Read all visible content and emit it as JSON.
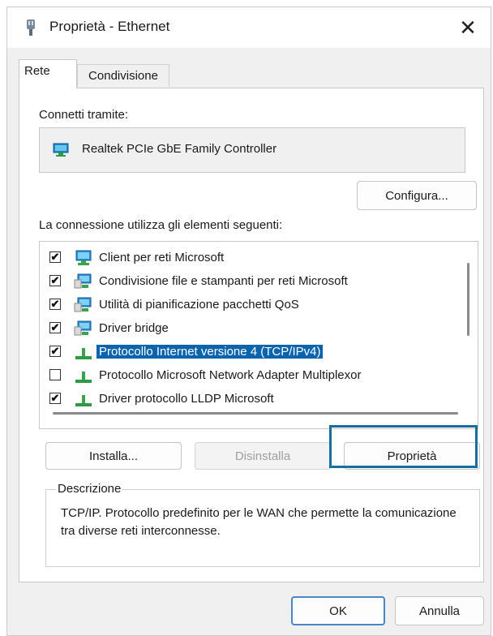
{
  "window": {
    "title": "Proprietà - Ethernet",
    "close_glyph": "✕"
  },
  "tabs": [
    {
      "label": "Rete",
      "active": true
    },
    {
      "label": "Condivisione",
      "active": false
    }
  ],
  "connect_via": {
    "label": "Connetti tramite:",
    "adapter_name": "Realtek PCIe GbE Family Controller",
    "adapter_icon": "network-adapter-icon",
    "configure_button": "Configura..."
  },
  "items": {
    "label": "La connessione utilizza gli elementi seguenti:",
    "list": [
      {
        "label": "Client per reti Microsoft",
        "checked": true,
        "icon": "network-client-icon"
      },
      {
        "label": "Condivisione file e stampanti per reti Microsoft",
        "checked": true,
        "icon": "network-service-icon"
      },
      {
        "label": "Utilità di pianificazione pacchetti QoS",
        "checked": true,
        "icon": "network-service-icon"
      },
      {
        "label": "Driver bridge",
        "checked": true,
        "icon": "network-service-icon"
      },
      {
        "label": "Protocollo Internet versione 4 (TCP/IPv4)",
        "checked": true,
        "icon": "protocol-icon",
        "selected": true
      },
      {
        "label": "Protocollo Microsoft Network Adapter Multiplexor",
        "checked": false,
        "icon": "protocol-icon"
      },
      {
        "label": "Driver protocollo LLDP Microsoft",
        "checked": true,
        "icon": "protocol-icon"
      }
    ]
  },
  "buttons": {
    "install": "Installa...",
    "uninstall": "Disinstalla",
    "properties": "Proprietà",
    "ok": "OK",
    "cancel": "Annulla"
  },
  "description": {
    "legend": "Descrizione",
    "text": "TCP/IP. Protocollo predefinito per le WAN che permette la comunicazione tra diverse reti interconnesse."
  },
  "colors": {
    "selection": "#0a64ad",
    "highlight_border": "#1a6da1",
    "primary_border": "#4a86c6"
  }
}
